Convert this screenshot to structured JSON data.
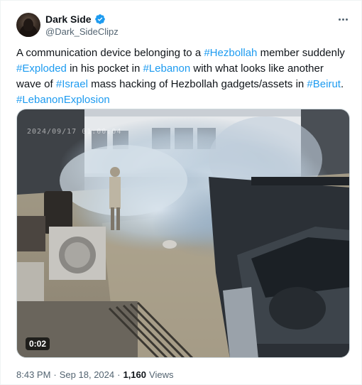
{
  "author": {
    "display_name": "Dark Side",
    "handle": "@Dark_SideClipz",
    "verified": true
  },
  "tweet": {
    "segments": [
      {
        "text": "A communication device belonging to a ",
        "tag": false
      },
      {
        "text": "#Hezbollah",
        "tag": true
      },
      {
        "text": " member suddenly ",
        "tag": false
      },
      {
        "text": "#Exploded",
        "tag": true
      },
      {
        "text": " in his pocket in ",
        "tag": false
      },
      {
        "text": "#Lebanon",
        "tag": true
      },
      {
        "text": " with what looks like another wave of ",
        "tag": false
      },
      {
        "text": "#Israel",
        "tag": true
      },
      {
        "text": " mass hacking of Hezbollah gadgets/assets in ",
        "tag": false
      },
      {
        "text": "#Beirut",
        "tag": true
      },
      {
        "text": ". ",
        "tag": false
      },
      {
        "text": "#LebanonExplosion",
        "tag": true
      }
    ]
  },
  "media": {
    "duration": "0:02",
    "camera_timestamp": "2024/09/17  01:00:04"
  },
  "meta": {
    "time": "8:43 PM",
    "separator": "·",
    "date": "Sep 18, 2024",
    "views_count": "1,160",
    "views_label": "Views"
  },
  "colors": {
    "accent": "#1d9bf0",
    "text": "#0f1419",
    "muted": "#536471"
  },
  "icons": [
    "verified-badge-icon",
    "more-options-icon"
  ]
}
